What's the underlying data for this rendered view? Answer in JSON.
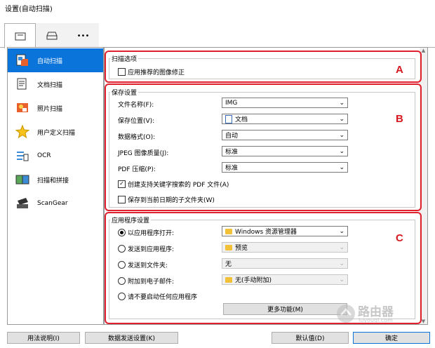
{
  "window": {
    "title": "设置(自动扫描)"
  },
  "tabs": [
    {
      "icon": "scan-computer-icon"
    },
    {
      "icon": "scanner-icon"
    },
    {
      "icon": "more-icon",
      "label": "•••"
    }
  ],
  "sidebar": {
    "items": [
      {
        "label": "自动扫描",
        "icon": "auto-scan-icon",
        "selected": true
      },
      {
        "label": "文档扫描",
        "icon": "document-scan-icon"
      },
      {
        "label": "照片扫描",
        "icon": "photo-scan-icon"
      },
      {
        "label": "用户定义扫描",
        "icon": "star-icon"
      },
      {
        "label": "OCR",
        "icon": "ocr-icon"
      },
      {
        "label": "扫描和拼接",
        "icon": "stitch-icon"
      },
      {
        "label": "ScanGear",
        "icon": "scangear-icon"
      }
    ]
  },
  "scan_options": {
    "section_label": "扫描选项",
    "letter": "A",
    "apply_correction": {
      "label": "应用推荐的图像修正",
      "checked": false
    }
  },
  "save_settings": {
    "section_label": "保存设置",
    "letter": "B",
    "file_name_label": "文件名称(F):",
    "file_name_value": "IMG",
    "save_in_label": "保存位置(V):",
    "save_in_value": "文档",
    "data_format_label": "数据格式(O):",
    "data_format_value": "自动",
    "jpeg_quality_label": "JPEG 图像质量(J):",
    "jpeg_quality_value": "标准",
    "pdf_compression_label": "PDF 压缩(P):",
    "pdf_compression_value": "标准",
    "create_keyword_pdf": {
      "label": "创建支持关键字搜索的 PDF 文件(A)",
      "checked": true
    },
    "save_subfolder": {
      "label": "保存到当前日期的子文件夹(W)",
      "checked": false
    }
  },
  "app_settings": {
    "section_label": "应用程序设置",
    "letter": "C",
    "open_with": {
      "label": "以应用程序打开:",
      "selected": true,
      "value": "Windows 资源管理器"
    },
    "send_to_app": {
      "label": "发送到应用程序:",
      "value": "预览"
    },
    "send_to_folder": {
      "label": "发送到文件夹:",
      "value": "无"
    },
    "attach_email": {
      "label": "附加到电子邮件:",
      "value": "无(手动附加)"
    },
    "no_app": {
      "label": "请不要启动任何应用程序"
    },
    "more_functions": "更多功能(M)"
  },
  "footer": {
    "instructions": "用法说明(I)",
    "default_settings": "数据发送设置(K)",
    "defaults": "默认值(D)",
    "ok": "确定"
  },
  "watermark": {
    "main": "路由器",
    "sub": "luyouqi.com"
  }
}
